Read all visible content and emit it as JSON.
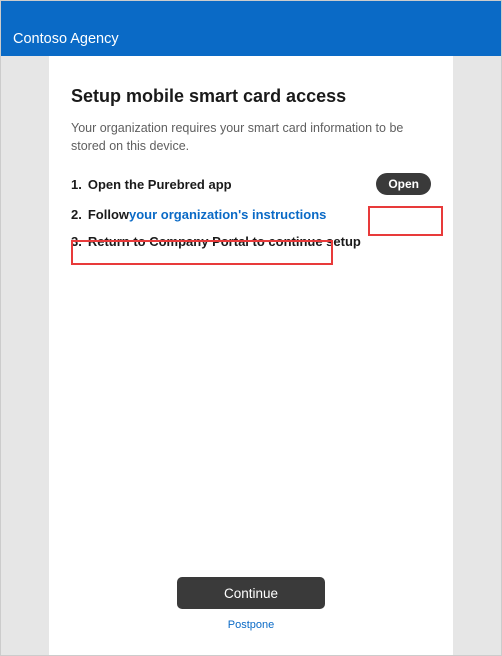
{
  "header": {
    "org_name": "Contoso Agency"
  },
  "page": {
    "title": "Setup mobile smart card access",
    "subtitle": "Your organization requires your smart card information to be stored on this device."
  },
  "steps": {
    "s1": {
      "num": "1.",
      "text": "Open the Purebred app",
      "action_label": "Open"
    },
    "s2": {
      "num": "2.",
      "prefix": "Follow ",
      "link": "your organization's instructions"
    },
    "s3": {
      "num": "3.",
      "text": "Return to Company Portal to continue setup"
    }
  },
  "actions": {
    "continue_label": "Continue",
    "postpone_label": "Postpone"
  }
}
